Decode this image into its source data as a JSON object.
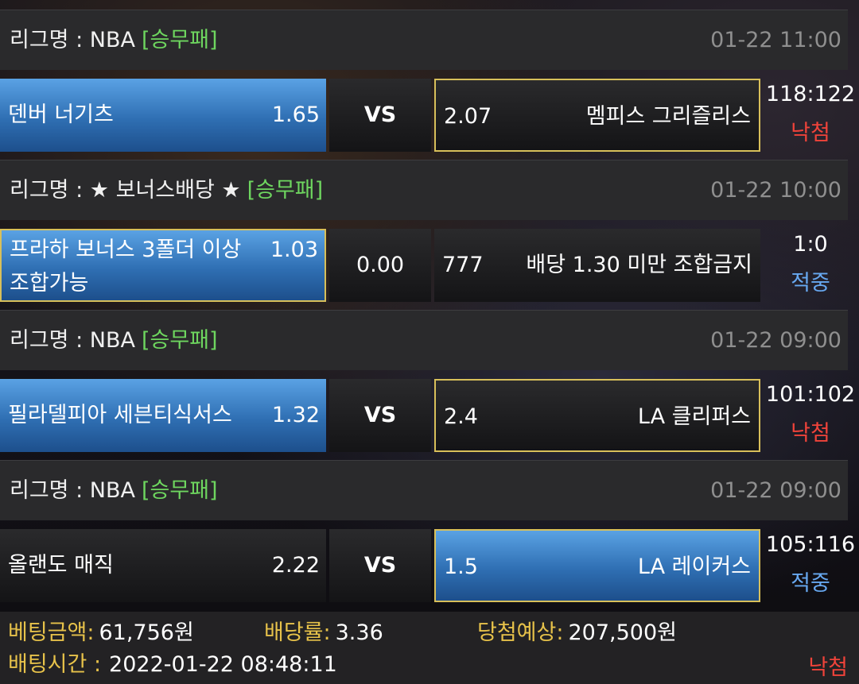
{
  "games": [
    {
      "league_prefix": "리그명 : ",
      "league_name": "NBA",
      "bet_type": "[승무패]",
      "datetime": "01-22 11:00",
      "home_team": "덴버 너기츠",
      "home_odds": "1.65",
      "middle": "VS",
      "away_odds": "2.07",
      "away_team": "멤피스 그리즐리스",
      "score": "118:122",
      "status": "낙첨"
    },
    {
      "league_prefix": "리그명 : ",
      "league_name": "★ 보너스배당 ★",
      "bet_type": "[승무패]",
      "datetime": "01-22 10:00",
      "home_team": "프라하 보너스 3폴더 이상 조합가능",
      "home_odds": "1.03",
      "middle": "0.00",
      "away_odds": "777",
      "away_team": "배당 1.30 미만 조합금지",
      "score": "1:0",
      "status": "적중"
    },
    {
      "league_prefix": "리그명 : ",
      "league_name": "NBA",
      "bet_type": "[승무패]",
      "datetime": "01-22 09:00",
      "home_team": "필라델피아 세븐티식서스",
      "home_odds": "1.32",
      "middle": "VS",
      "away_odds": "2.4",
      "away_team": "LA 클리퍼스",
      "score": "101:102",
      "status": "낙첨"
    },
    {
      "league_prefix": "리그명 : ",
      "league_name": "NBA",
      "bet_type": "[승무패]",
      "datetime": "01-22 09:00",
      "home_team": "올랜도 매직",
      "home_odds": "2.22",
      "middle": "VS",
      "away_odds": "1.5",
      "away_team": "LA 레이커스",
      "score": "105:116",
      "status": "적중"
    }
  ],
  "summary": {
    "bet_amount_label": "베팅금액:",
    "bet_amount_value": "61,756원",
    "odds_label": "배당률:",
    "odds_value": "3.36",
    "expected_win_label": "당첨예상:",
    "expected_win_value": "207,500원",
    "bet_time_label": "배팅시간 :",
    "bet_time_value": "2022-01-22 08:48:11",
    "final_status": "낙첨"
  },
  "colors": {
    "bet_type_green": "#6ed65f",
    "selected_blue": "#3b82c8",
    "gold_border": "#d8bf5a",
    "lose_red": "#f0433a",
    "win_blue": "#67a8f0",
    "label_gold": "#e7c24a"
  }
}
